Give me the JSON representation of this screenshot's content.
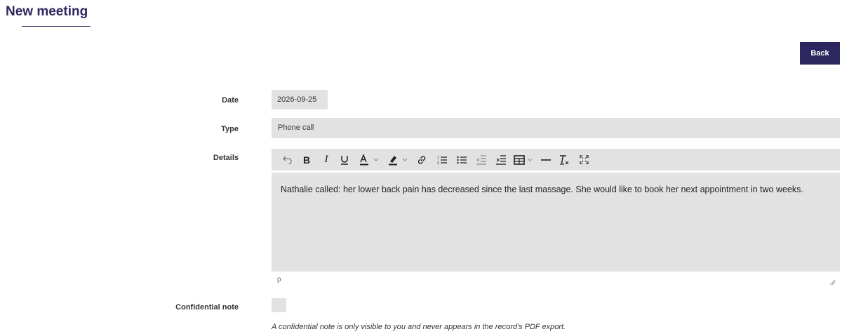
{
  "page": {
    "title": "New meeting"
  },
  "actions": {
    "back_label": "Back"
  },
  "form": {
    "date": {
      "label": "Date",
      "value": "2026-09-25"
    },
    "type": {
      "label": "Type",
      "value": "Phone call"
    },
    "details": {
      "label": "Details",
      "toolbar": [
        "undo-icon",
        "bold-icon",
        "italic-icon",
        "underline-icon",
        "text-color-icon",
        "highlight-icon",
        "link-icon",
        "numbered-list-icon",
        "bulleted-list-icon",
        "outdent-icon",
        "indent-icon",
        "table-icon",
        "horizontal-rule-icon",
        "clear-formatting-icon",
        "fullscreen-icon"
      ],
      "content": "Nathalie called: her lower back pain has decreased since the last massage. She would like to book her next appointment in two weeks.",
      "status_path": "p"
    },
    "confidential": {
      "label": "Confidential note",
      "checked": false,
      "help": "A confidential note is only visible to you and never appears in the record's PDF export."
    }
  }
}
